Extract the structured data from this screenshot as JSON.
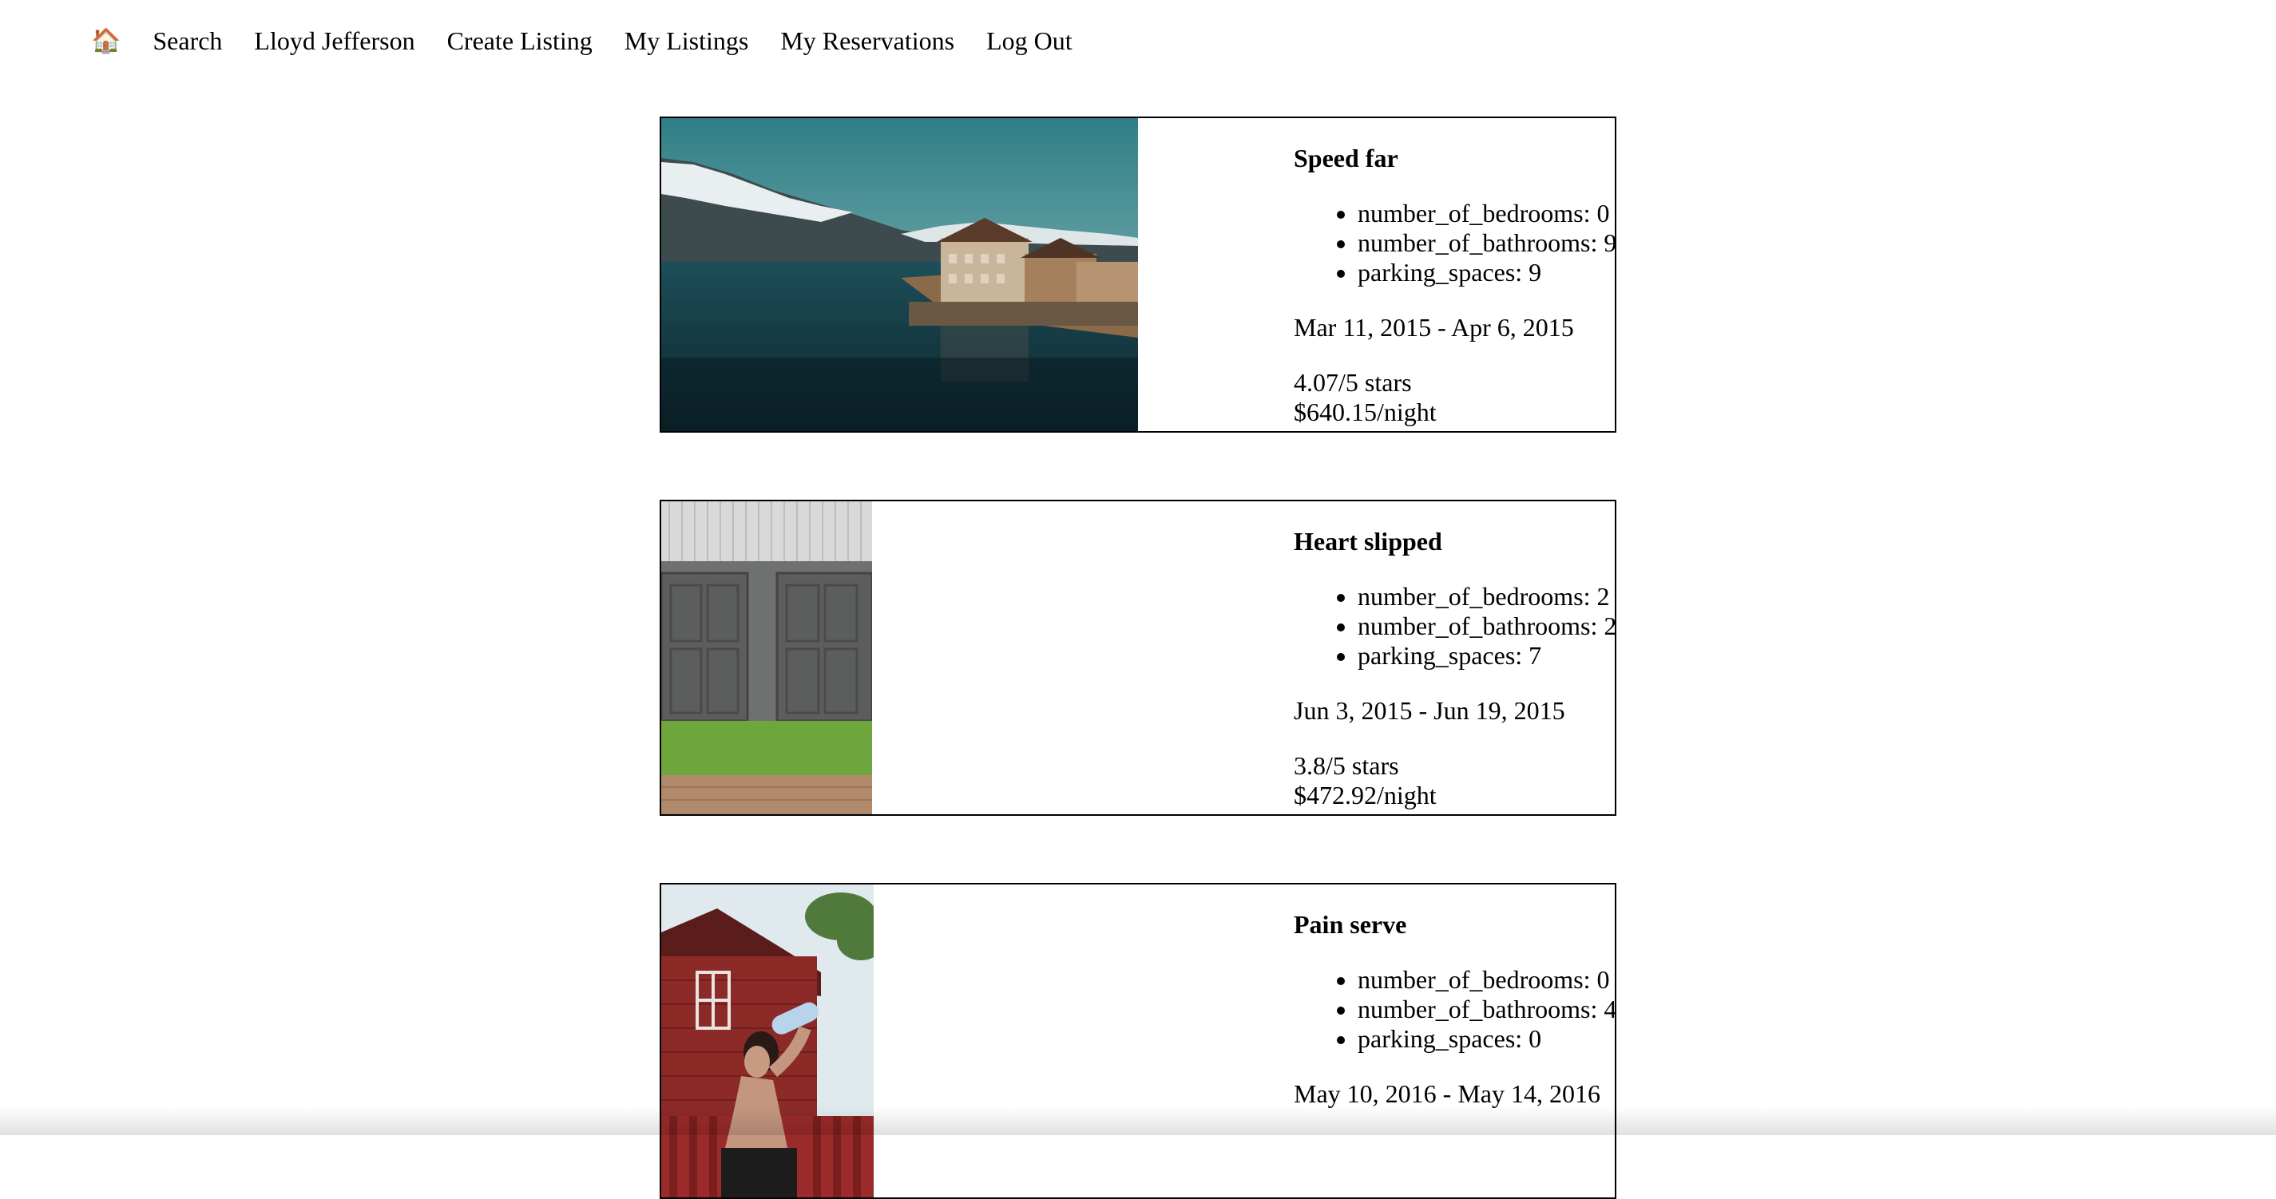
{
  "nav": {
    "home_icon": "🏠",
    "links": [
      "Search",
      "Lloyd Jefferson",
      "Create Listing",
      "My Listings",
      "My Reservations",
      "Log Out"
    ]
  },
  "listings": [
    {
      "title": "Speed far",
      "features": [
        "number_of_bedrooms: 0",
        "number_of_bathrooms: 9",
        "parking_spaces: 9"
      ],
      "dates": "Mar 11, 2015 - Apr 6, 2015",
      "rating": "4.07/5 stars",
      "price": "$640.15/night"
    },
    {
      "title": "Heart slipped",
      "features": [
        "number_of_bedrooms: 2",
        "number_of_bathrooms: 2",
        "parking_spaces: 7"
      ],
      "dates": "Jun 3, 2015 - Jun 19, 2015",
      "rating": "3.8/5 stars",
      "price": "$472.92/night"
    },
    {
      "title": "Pain serve",
      "features": [
        "number_of_bedrooms: 0",
        "number_of_bathrooms: 4",
        "parking_spaces: 0"
      ],
      "dates": "May 10, 2016 - May 14, 2016",
      "rating": "",
      "price": ""
    }
  ]
}
